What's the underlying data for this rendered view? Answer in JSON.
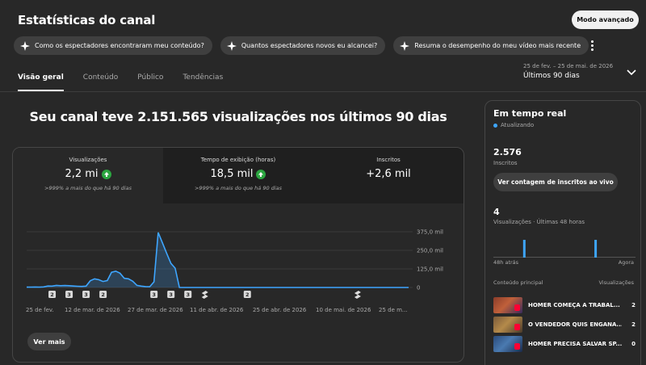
{
  "header": {
    "title": "Estatísticas do canal",
    "advanced_mode": "Modo avançado"
  },
  "suggestions": [
    "Como os espectadores encontraram meu conteúdo?",
    "Quantos espectadores novos eu alcancei?",
    "Resuma o desempenho do meu vídeo mais recente"
  ],
  "tabs": [
    {
      "label": "Visão geral",
      "active": true
    },
    {
      "label": "Conteúdo",
      "active": false
    },
    {
      "label": "Público",
      "active": false
    },
    {
      "label": "Tendências",
      "active": false
    }
  ],
  "date_range": {
    "range": "25 de fev. – 25 de mai. de 2026",
    "preset": "Últimos 90 dias"
  },
  "headline": "Seu canal teve 2.151.565 visualizações nos últimos 90 dias",
  "kpis": [
    {
      "label": "Visualizações",
      "value": "2,2 mi",
      "trend_up": true,
      "note": ">999% a mais do que há 90 dias"
    },
    {
      "label": "Tempo de exibição (horas)",
      "value": "18,5 mil",
      "trend_up": true,
      "note": ">999% a mais do que há 90 dias"
    },
    {
      "label": "Inscritos",
      "value": "+2,6 mil",
      "trend_up": false,
      "note": ""
    }
  ],
  "chart_data": {
    "type": "area",
    "series": [
      {
        "values": [
          2,
          2,
          3,
          2,
          4,
          10,
          9,
          14,
          12,
          13,
          12,
          10,
          8,
          7,
          9,
          45,
          58,
          52,
          40,
          47,
          102,
          110,
          96,
          62,
          58,
          42,
          14,
          9,
          6,
          5,
          38,
          370,
          300,
          230,
          162,
          130,
          0,
          0,
          0,
          0,
          0,
          0,
          0,
          0,
          0,
          0,
          0,
          0,
          0,
          0,
          0,
          0,
          0,
          0,
          0,
          0,
          0,
          0,
          0,
          0,
          0,
          0,
          0,
          0,
          0,
          0,
          0,
          0,
          0,
          0,
          0,
          0,
          0,
          0,
          0,
          0,
          0,
          0,
          0,
          0,
          0,
          0,
          0,
          0,
          0,
          0,
          0,
          0,
          0,
          0,
          0
        ]
      }
    ],
    "x_tick_labels": [
      "25 de fev.",
      "12 de mar. de 2026",
      "27 de mar. de 2026",
      "11 de abr. de 2026",
      "25 de abr. de 2026",
      "10 de mai. de 2026",
      "25 de m..."
    ],
    "y_tick_labels": [
      "375,0 mil",
      "250,0 mil",
      "125,0 mil",
      "0"
    ],
    "ylim": [
      0,
      375
    ],
    "y_unit": "mil",
    "event_markers": [
      {
        "day": 6,
        "label": "2"
      },
      {
        "day": 10,
        "label": "3"
      },
      {
        "day": 14,
        "label": "3"
      },
      {
        "day": 18,
        "label": "2"
      },
      {
        "day": 30,
        "label": "3"
      },
      {
        "day": 34,
        "label": "3"
      },
      {
        "day": 38,
        "label": "3"
      },
      {
        "day": 42,
        "label": "",
        "icon": "shorts-icon"
      },
      {
        "day": 52,
        "label": "2"
      },
      {
        "day": 78,
        "label": "",
        "icon": "shorts-icon"
      }
    ],
    "grid": true
  },
  "see_more": "Ver mais",
  "realtime": {
    "title": "Em tempo real",
    "status": "Atualizando",
    "subscribers_value": "2.576",
    "subscribers_label": "Inscritos",
    "live_button": "Ver contagem de inscritos ao vivo",
    "views_value": "4",
    "views_label": "Visualizações · Últimas 48 horas",
    "mini_chart": {
      "type": "bar",
      "hours": 48,
      "values_nonzero_at": [
        {
          "hour_index": 10,
          "value": 2
        },
        {
          "hour_index": 34,
          "value": 2
        }
      ]
    },
    "axis_left": "48h atrás",
    "axis_right": "Agora",
    "top_content_header": "Conteúdo principal",
    "top_content_metric": "Visualizações",
    "top_content": [
      {
        "title": "HOMER COMEÇA A TRABAL...",
        "views": "2"
      },
      {
        "title": "O VENDEDOR QUIS ENGANA...",
        "views": "2"
      },
      {
        "title": "HOMER PRECISA SALVAR SP...",
        "views": "0"
      }
    ]
  },
  "colors": {
    "accent": "#3ea6ff",
    "trend_up": "#2ba640",
    "background": "#282828"
  }
}
